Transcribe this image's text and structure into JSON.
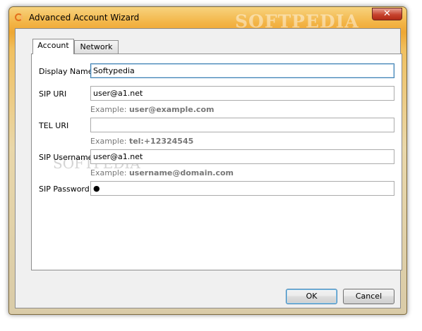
{
  "window": {
    "title": "Advanced Account Wizard",
    "close_glyph": "✕",
    "watermark": "SOFTPEDIA"
  },
  "tabs": [
    {
      "label": "Account",
      "selected": true
    },
    {
      "label": "Network",
      "selected": false
    }
  ],
  "form": {
    "display_name": {
      "label": "Display Name",
      "value": "Softypedia"
    },
    "sip_uri": {
      "label": "SIP URI",
      "value": "user@a1.net",
      "example_prefix": "Example:",
      "example_value": "user@example.com"
    },
    "tel_uri": {
      "label": "TEL URI",
      "value": "",
      "example_prefix": "Example:",
      "example_value": "tel:+12324545"
    },
    "sip_username": {
      "label": "SIP Username",
      "value": "user@a1.net",
      "example_prefix": "Example:",
      "example_value": "username@domain.com"
    },
    "sip_password": {
      "label": "SIP Password",
      "value": "●"
    }
  },
  "panel_watermark": "SOFTPEDIA",
  "buttons": {
    "ok": "OK",
    "cancel": "Cancel"
  },
  "colors": {
    "accent": "#eea733",
    "focus": "#3c7fb1"
  }
}
